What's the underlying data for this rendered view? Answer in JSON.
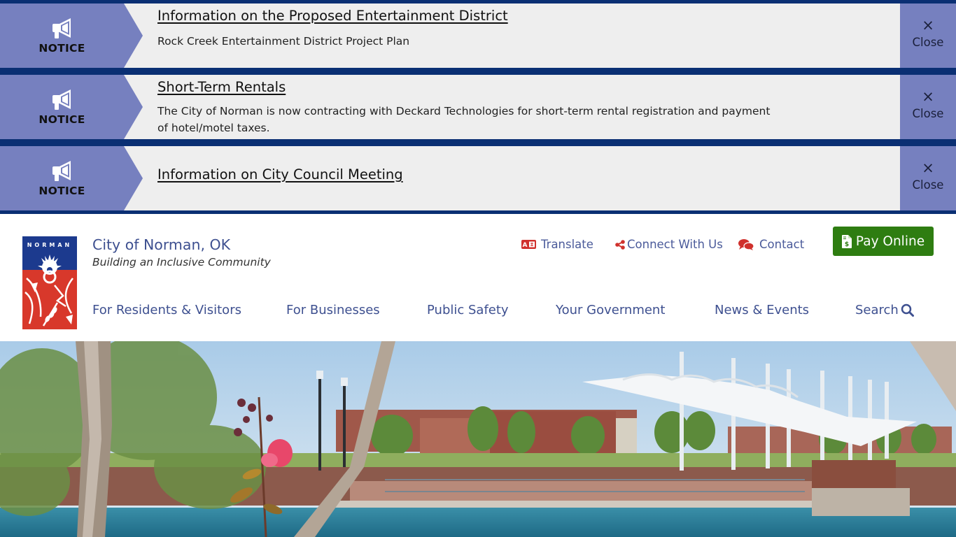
{
  "notices": [
    {
      "tag": "NOTICE",
      "icon": "megaphone-icon",
      "title": "Information on the Proposed Entertainment District",
      "description": "Rock Creek Entertainment District Project Plan",
      "close_label": "Close",
      "close_icon": "×"
    },
    {
      "tag": "NOTICE",
      "icon": "megaphone-icon",
      "title": "Short-Term Rentals",
      "description": "The City of Norman is now contracting with Deckard Technologies for short-term rental registration and payment of hotel/motel taxes.",
      "close_label": "Close",
      "close_icon": "×"
    },
    {
      "tag": "NOTICE",
      "icon": "megaphone-icon",
      "title": "Information on City Council Meeting",
      "description": "",
      "close_label": "Close",
      "close_icon": "×"
    }
  ],
  "header": {
    "logo_text": "NORMAN",
    "site_title": "City of Norman, OK",
    "tagline": "Building an Inclusive Community",
    "utility_links": [
      {
        "label": "Translate",
        "icon": "translate-icon"
      },
      {
        "label": "Connect With Us",
        "icon": "share-icon"
      },
      {
        "label": "Contact",
        "icon": "chat-bubbles-icon"
      }
    ],
    "pay_button": {
      "label": "Pay Online",
      "icon": "invoice-dollar-icon"
    }
  },
  "nav": {
    "items": [
      {
        "label": "For Residents & Visitors"
      },
      {
        "label": "For Businesses"
      },
      {
        "label": "Public Safety"
      },
      {
        "label": "Your Government"
      },
      {
        "label": "News & Events"
      }
    ],
    "search_label": "Search"
  },
  "colors": {
    "notice_band": "#0a2f73",
    "notice_tag": "#7680bf",
    "notice_bg": "#eeeeee",
    "link_blue": "#3e5090",
    "pay_green": "#2e7d11",
    "icon_red": "#d0312d"
  },
  "hero": {
    "description": "Photo of Norman city park with white tensile canopy structure, pond, trees and flowering crape myrtle"
  }
}
